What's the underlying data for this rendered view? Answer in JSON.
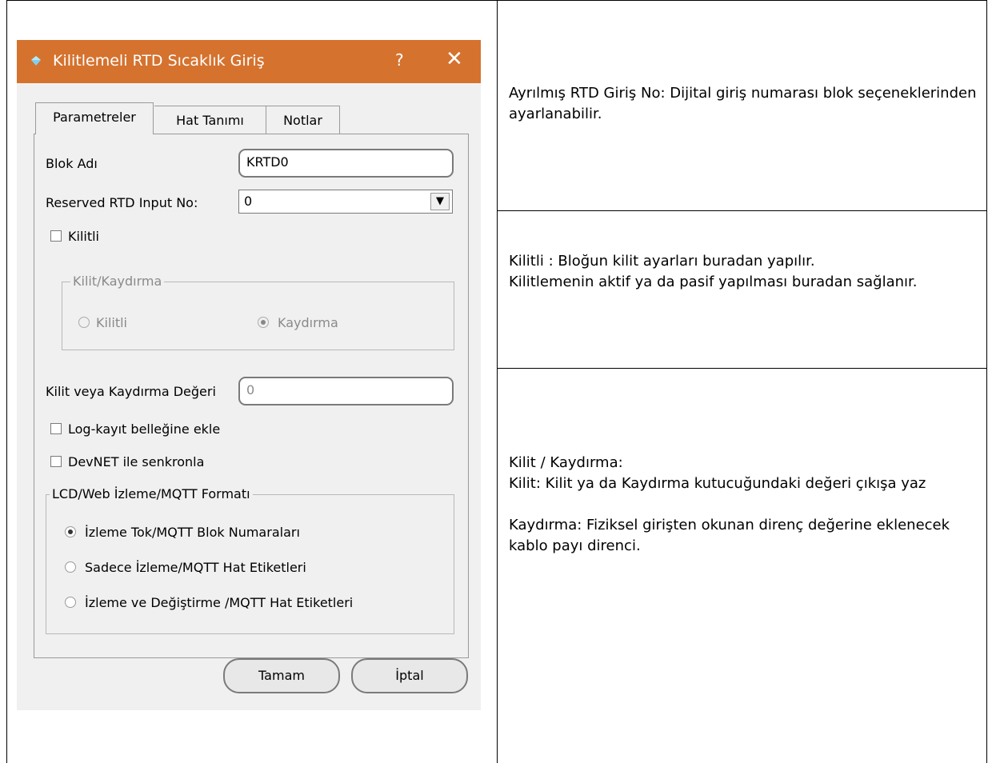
{
  "dialog": {
    "title": "Kilitlemeli RTD Sıcaklık Giriş",
    "help_label": "?",
    "close_label": "✕",
    "tabs": [
      {
        "label": "Parametreler"
      },
      {
        "label": "Hat Tanımı"
      },
      {
        "label": "Notlar"
      }
    ],
    "block_name": {
      "label": "Blok Adı",
      "value": "KRTD0"
    },
    "rtd_input": {
      "label": "Reserved RTD Input No:",
      "value": "0"
    },
    "locked_checkbox": {
      "label": "Kilitli",
      "checked": false
    },
    "lock_group": {
      "title": "Kilit/Kaydırma",
      "option_locked": "Kilitli",
      "option_shift": "Kaydırma",
      "selected": "Kaydırma"
    },
    "lock_value": {
      "label": "Kilit veya Kaydırma Değeri",
      "placeholder": "0"
    },
    "log_checkbox": {
      "label": "Log-kayıt belleğine ekle",
      "checked": false
    },
    "devnet_checkbox": {
      "label": "DevNET ile senkronla",
      "checked": false
    },
    "format_group": {
      "title": "LCD/Web İzleme/MQTT Formatı",
      "options": [
        "İzleme Tok/MQTT Blok Numaraları",
        "Sadece İzleme/MQTT Hat Etiketleri",
        "İzleme ve Değiştirme /MQTT Hat Etiketleri"
      ],
      "selected_index": 0
    },
    "ok_label": "Tamam",
    "cancel_label": "İptal"
  },
  "notes": {
    "rtd_input_note": "Ayrılmış RTD Giriş No:  Dijital giriş numarası blok seçeneklerinden ayarlanabilir.",
    "locked_note_1": "Kilitli :  Bloğun kilit ayarları buradan yapılır.",
    "locked_note_2": "Kilitlemenin aktif ya da pasif yapılması buradan sağlanır.",
    "lock_shift_heading": "Kilit / Kaydırma:",
    "lock_desc": "Kilit:  Kilit ya da Kaydırma kutucuğundaki değeri çıkışa yaz",
    "shift_desc": "Kaydırma:  Fiziksel girişten okunan direnç değerine eklenecek kablo payı direnci."
  },
  "colors": {
    "titlebar": "#d5722e",
    "dialog_bg": "#f0f0f0"
  }
}
